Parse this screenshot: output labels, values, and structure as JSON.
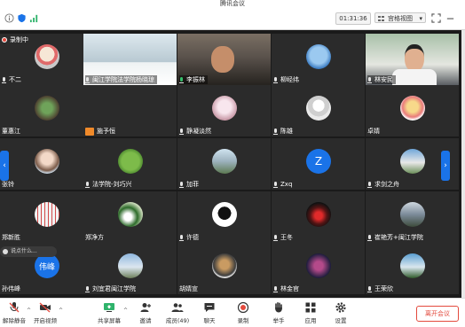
{
  "window": {
    "title": "腾讯会议"
  },
  "toolbar": {
    "timer": "01:31:36",
    "view_mode": "宫格视图",
    "view_caret": "▾"
  },
  "recording": {
    "label": "录制中"
  },
  "tiles": [
    {
      "name": "不二",
      "mic": "off"
    },
    {
      "name": "闽江学院法学院杨晓琼",
      "mic": "off"
    },
    {
      "name": "李振林",
      "mic": "green"
    },
    {
      "name": "柳经纬",
      "mic": "off"
    },
    {
      "name": "林安民",
      "mic": "off"
    },
    {
      "name": "董惠江",
      "mic": "none"
    },
    {
      "name": "施予恒",
      "mic": "none"
    },
    {
      "name": "静凝淡然",
      "mic": "off"
    },
    {
      "name": "陈雄",
      "mic": "off"
    },
    {
      "name": "卓婧",
      "mic": "none"
    },
    {
      "name": "张铃",
      "mic": "none"
    },
    {
      "name": "法学院-刘巧兴",
      "mic": "off"
    },
    {
      "name": "加菲",
      "mic": "off"
    },
    {
      "name": "Zxq",
      "mic": "off"
    },
    {
      "name": "求剑之舟",
      "mic": "off"
    },
    {
      "name": "郑新胜",
      "mic": "none"
    },
    {
      "name": "郑净方",
      "mic": "none"
    },
    {
      "name": "许德",
      "mic": "off"
    },
    {
      "name": "王冬",
      "mic": "off"
    },
    {
      "name": "崔艳芳+闽江学院",
      "mic": "off"
    },
    {
      "name": "孙伟峰",
      "mic": "none"
    },
    {
      "name": "刘宜君闽江学院",
      "mic": "off"
    },
    {
      "name": "胡婧宣",
      "mic": "none"
    },
    {
      "name": "林金官",
      "mic": "off"
    },
    {
      "name": "王荣欣",
      "mic": "off"
    }
  ],
  "avatars": {
    "zxq_letter": "Z",
    "wf_letter": "伟峰"
  },
  "side_nav": {
    "left": "‹",
    "right": "›"
  },
  "chat_pill": {
    "text": "说点什么..."
  },
  "bottom": {
    "unmute": "解除静音",
    "start_video": "开启视频",
    "share": "共享屏幕",
    "invite": "邀请",
    "members": "成员(49)",
    "chat": "聊天",
    "record": "录制",
    "raise_hand": "举手",
    "apps": "应用",
    "settings": "设置",
    "leave": "离开会议",
    "caret": "^"
  },
  "colors": {
    "accent": "#1a73e8",
    "danger": "#e34a3d",
    "tile_bg": "#2b2b2b"
  }
}
